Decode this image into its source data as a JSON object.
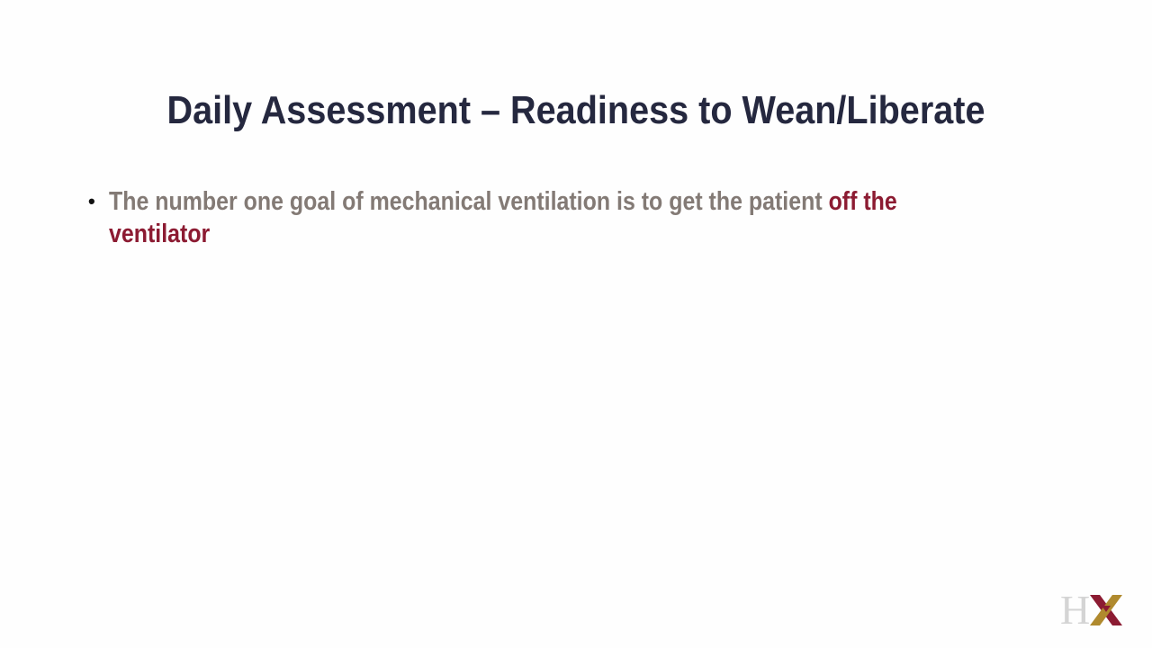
{
  "slide": {
    "title": "Daily Assessment – Readiness to Wean/Liberate",
    "bullets": [
      {
        "marker": "•",
        "line1_plain": "The number one goal of mechanical ventilation is to get the patient ",
        "line1_emph": "off the",
        "line2_emph": "ventilator"
      }
    ]
  },
  "logo": {
    "text": "HX",
    "colors": {
      "h": "#d4d4d4",
      "x_left": "#8c1b32",
      "x_right": "#b08a2e"
    }
  },
  "colors": {
    "title": "#25283f",
    "body": "#837a75",
    "emphasis": "#8c1b32",
    "background": "#fefefe"
  }
}
